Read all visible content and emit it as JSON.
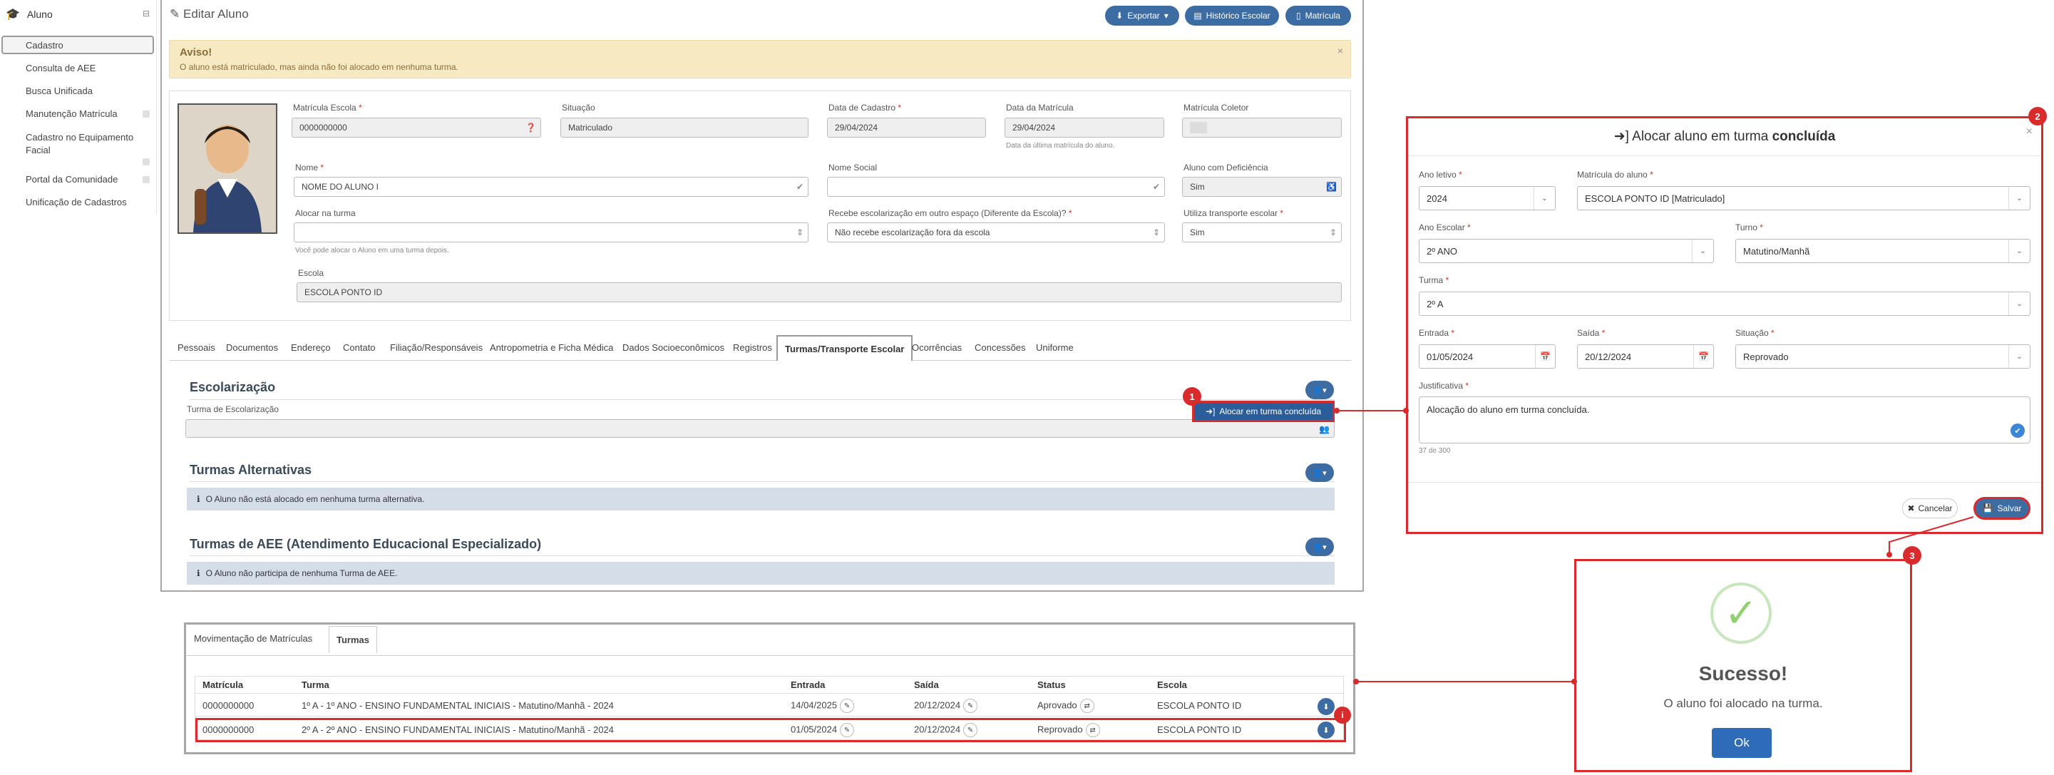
{
  "sidebar": {
    "title": "Aluno",
    "items": [
      {
        "label": "Cadastro"
      },
      {
        "label": "Consulta de AEE"
      },
      {
        "label": "Busca Unificada"
      },
      {
        "label": "Manutenção Matrícula"
      },
      {
        "label": "Cadastro no Equipamento Facial"
      },
      {
        "label": "Portal da Comunidade"
      },
      {
        "label": "Unificação de Cadastros"
      }
    ]
  },
  "header": {
    "title": "Editar Aluno",
    "export_label": "Exportar",
    "history_label": "Histórico Escolar",
    "matricula_label": "Matrícula"
  },
  "alert": {
    "title": "Aviso!",
    "message": "O aluno está matriculado, mas ainda não foi alocado em nenhuma turma."
  },
  "form": {
    "matricula_escola": {
      "label": "Matrícula Escola",
      "value": "0000000000"
    },
    "situacao": {
      "label": "Situação",
      "value": "Matriculado"
    },
    "data_cadastro": {
      "label": "Data de Cadastro",
      "value": "29/04/2024"
    },
    "data_matricula": {
      "label": "Data da Matrícula",
      "value": "29/04/2024",
      "hint": "Data da última matrícula do aluno."
    },
    "matricula_coletor": {
      "label": "Matrícula Coletor"
    },
    "nome": {
      "label": "Nome",
      "value": "NOME DO ALUNO I"
    },
    "nome_social": {
      "label": "Nome Social"
    },
    "deficiencia": {
      "label": "Aluno com Deficiência",
      "value": "Sim"
    },
    "alocar": {
      "label": "Alocar na turma",
      "hint": "Você pode alocar o Aluno em uma turma depois."
    },
    "recebe": {
      "label": "Recebe escolarização em outro espaço (Diferente da Escola)?",
      "value": "Não recebe escolarização fora da escola"
    },
    "transporte": {
      "label": "Utiliza transporte escolar",
      "value": "Sim"
    },
    "escola": {
      "label": "Escola",
      "value": "ESCOLA PONTO ID"
    }
  },
  "tabs": [
    "Pessoais",
    "Documentos",
    "Endereço",
    "Contato",
    "Filiação/Responsáveis",
    "Antropometria e Ficha Médica",
    "Dados Socioeconômicos",
    "Registros",
    "Turmas/Transporte Escolar",
    "Ocorrências",
    "Concessões",
    "Uniforme"
  ],
  "escolarizacao": {
    "title": "Escolarização",
    "field_label": "Turma de Escolarização",
    "dropdown_item": "Alocar em turma concluída"
  },
  "alternativas": {
    "title": "Turmas Alternativas",
    "info": "O Aluno não está alocado em nenhuma turma alternativa."
  },
  "aee": {
    "title": "Turmas de AEE (Atendimento Educacional Especializado)",
    "info": "O Aluno não participa de nenhuma Turma de AEE."
  },
  "modal": {
    "title_prefix": "Alocar aluno em turma",
    "title_bold": "concluída",
    "ano_letivo": {
      "label": "Ano letivo",
      "value": "2024"
    },
    "matricula": {
      "label": "Matrícula do aluno",
      "value": "ESCOLA PONTO ID [Matriculado]"
    },
    "ano_escolar": {
      "label": "Ano Escolar",
      "value": "2º ANO"
    },
    "turno": {
      "label": "Turno",
      "value": "Matutino/Manhã"
    },
    "turma": {
      "label": "Turma",
      "value": "2º A"
    },
    "entrada": {
      "label": "Entrada",
      "value": "01/05/2024"
    },
    "saida": {
      "label": "Saída",
      "value": "20/12/2024"
    },
    "situacao": {
      "label": "Situação",
      "value": "Reprovado"
    },
    "justificativa": {
      "label": "Justificativa",
      "value": "Alocação do aluno em turma concluída.",
      "counter": "37 de 300"
    },
    "cancel": "Cancelar",
    "save": "Salvar"
  },
  "success": {
    "title": "Sucesso!",
    "message": "O aluno foi alocado na turma.",
    "ok": "Ok"
  },
  "bottom": {
    "tabs": [
      "Movimentação de Matrículas",
      "Turmas"
    ],
    "columns": [
      "Matrícula",
      "Turma",
      "Entrada",
      "Saída",
      "Status",
      "Escola"
    ],
    "rows": [
      {
        "matricula": "0000000000",
        "turma": "1º A - 1º ANO - ENSINO FUNDAMENTAL INICIAIS - Matutino/Manhã - 2024",
        "entrada": "14/04/2025",
        "saida": "20/12/2024",
        "status": "Aprovado",
        "escola": "ESCOLA PONTO ID"
      },
      {
        "matricula": "0000000000",
        "turma": "2º A - 2º ANO - ENSINO FUNDAMENTAL INICIAIS - Matutino/Manhã - 2024",
        "entrada": "01/05/2024",
        "saida": "20/12/2024",
        "status": "Reprovado",
        "escola": "ESCOLA PONTO ID"
      }
    ]
  },
  "badges": [
    "1",
    "2",
    "3",
    "i"
  ],
  "colors": {
    "primary": "#3c6ca2",
    "highlight": "#d92b2b",
    "alert_bg": "#f7eac3"
  }
}
